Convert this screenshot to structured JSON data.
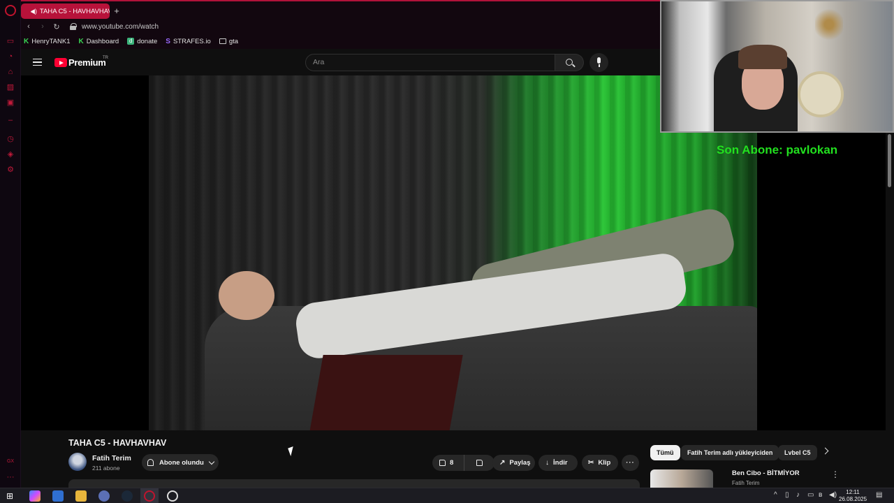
{
  "browser": {
    "tab_title": "TAHA C5 - HAVHAVHAV",
    "url": "www.youtube.com/watch",
    "bookmarks": [
      "HenryTANK1",
      "Dashboard",
      "donate",
      "STRAFES.io",
      "gta"
    ]
  },
  "youtube": {
    "brand": "Premium",
    "region": "TR",
    "search_placeholder": "Ara"
  },
  "stream_overlay": {
    "last_subscriber": "Son Abone: pavlokan"
  },
  "video": {
    "title": "TAHA C5 - HAVHAVHAV",
    "channel": "Fatih Terim",
    "subscribers": "211 abone",
    "subscribe_label": "Abone olundu",
    "like_count": "8",
    "share_label": "Paylaş",
    "download_label": "İndir",
    "clip_label": "Klip",
    "more_label": "···"
  },
  "recommendations": {
    "chips": [
      "Tümü",
      "Fatih Terim adlı yükleyiciden",
      "Lvbel C5"
    ],
    "first_title": "Ben Cibo - BİTMİYOR",
    "first_channel": "Fatih Terim"
  },
  "taskbar": {
    "time": "12:11",
    "date": "26.08.2025"
  },
  "colors": {
    "opera_red": "#b7123a",
    "overlay_green": "#22e01f",
    "youtube_red": "#ff0033"
  }
}
